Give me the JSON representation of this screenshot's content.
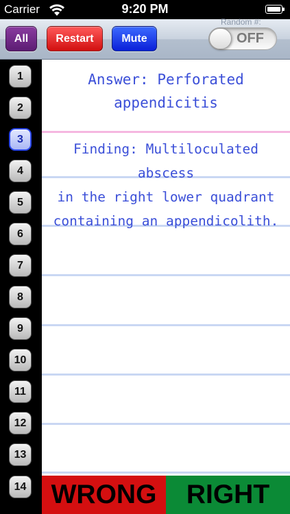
{
  "status_bar": {
    "carrier": "Carrier",
    "time": "9:20 PM",
    "icons": [
      "wifi-icon",
      "battery-icon"
    ]
  },
  "toolbar": {
    "all_label": "All",
    "restart_label": "Restart",
    "mute_label": "Mute",
    "random_label": "Random #:",
    "toggle_state": "OFF"
  },
  "cards": [
    {
      "label": "1"
    },
    {
      "label": "2"
    },
    {
      "label": "3"
    },
    {
      "label": "4"
    },
    {
      "label": "5"
    },
    {
      "label": "6"
    },
    {
      "label": "7"
    },
    {
      "label": "8"
    },
    {
      "label": "9"
    },
    {
      "label": "10"
    },
    {
      "label": "11"
    },
    {
      "label": "12"
    },
    {
      "label": "13"
    },
    {
      "label": "14"
    }
  ],
  "selected_card": "3",
  "content": {
    "answer_line1": "Answer: Perforated",
    "answer_line2": "appendicitis",
    "finding_line1": "Finding: Multiloculated abscess",
    "finding_line2": "in the right lower quadrant",
    "finding_line3": "containing an appendicolith."
  },
  "buttons": {
    "wrong_label": "WRONG",
    "right_label": "RIGHT"
  },
  "colors": {
    "all": "#6b2a85",
    "restart": "#e21b1b",
    "mute": "#1431f0",
    "wrong": "#d40f10",
    "right": "#0b8a36",
    "text_blue": "#3b4fd8"
  }
}
